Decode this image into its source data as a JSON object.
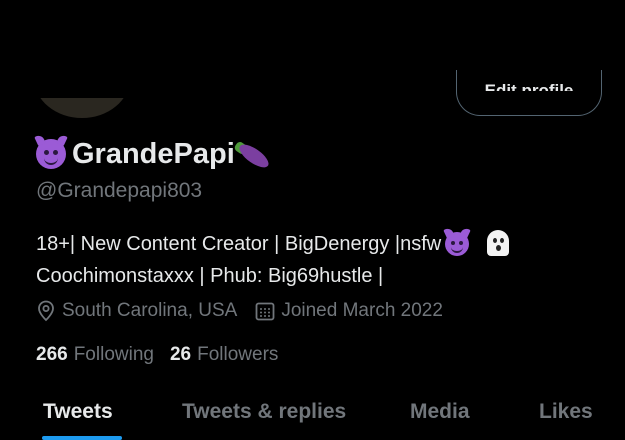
{
  "profile": {
    "edit_button_label": "Edit profile",
    "display_name": "GrandePapi",
    "handle": "@Grandepapi803",
    "bio_line1": "18+| New Content Creator | BigDenergy |nsfw",
    "bio_line2": "Coochimonstaxxx | Phub: Big69hustle |",
    "location": "South Carolina, USA",
    "joined": "Joined March 2022",
    "following_count": "266",
    "following_label": "Following",
    "followers_count": "26",
    "followers_label": "Followers"
  },
  "tabs": [
    {
      "label": "Tweets",
      "active": true
    },
    {
      "label": "Tweets & replies",
      "active": false
    },
    {
      "label": "Media",
      "active": false
    },
    {
      "label": "Likes",
      "active": false
    }
  ],
  "icons": {
    "name_prefix": "smiling-devil-emoji",
    "name_suffix": "eggplant-emoji",
    "bio_emoji_1": "smiling-devil-emoji",
    "bio_emoji_2": "ghost-emoji",
    "location": "location-pin-icon",
    "joined": "calendar-icon"
  },
  "colors": {
    "background": "#000000",
    "primary_text": "#e7e9ea",
    "secondary_text": "#71767b",
    "accent": "#1d9bf0",
    "border": "#536471"
  }
}
